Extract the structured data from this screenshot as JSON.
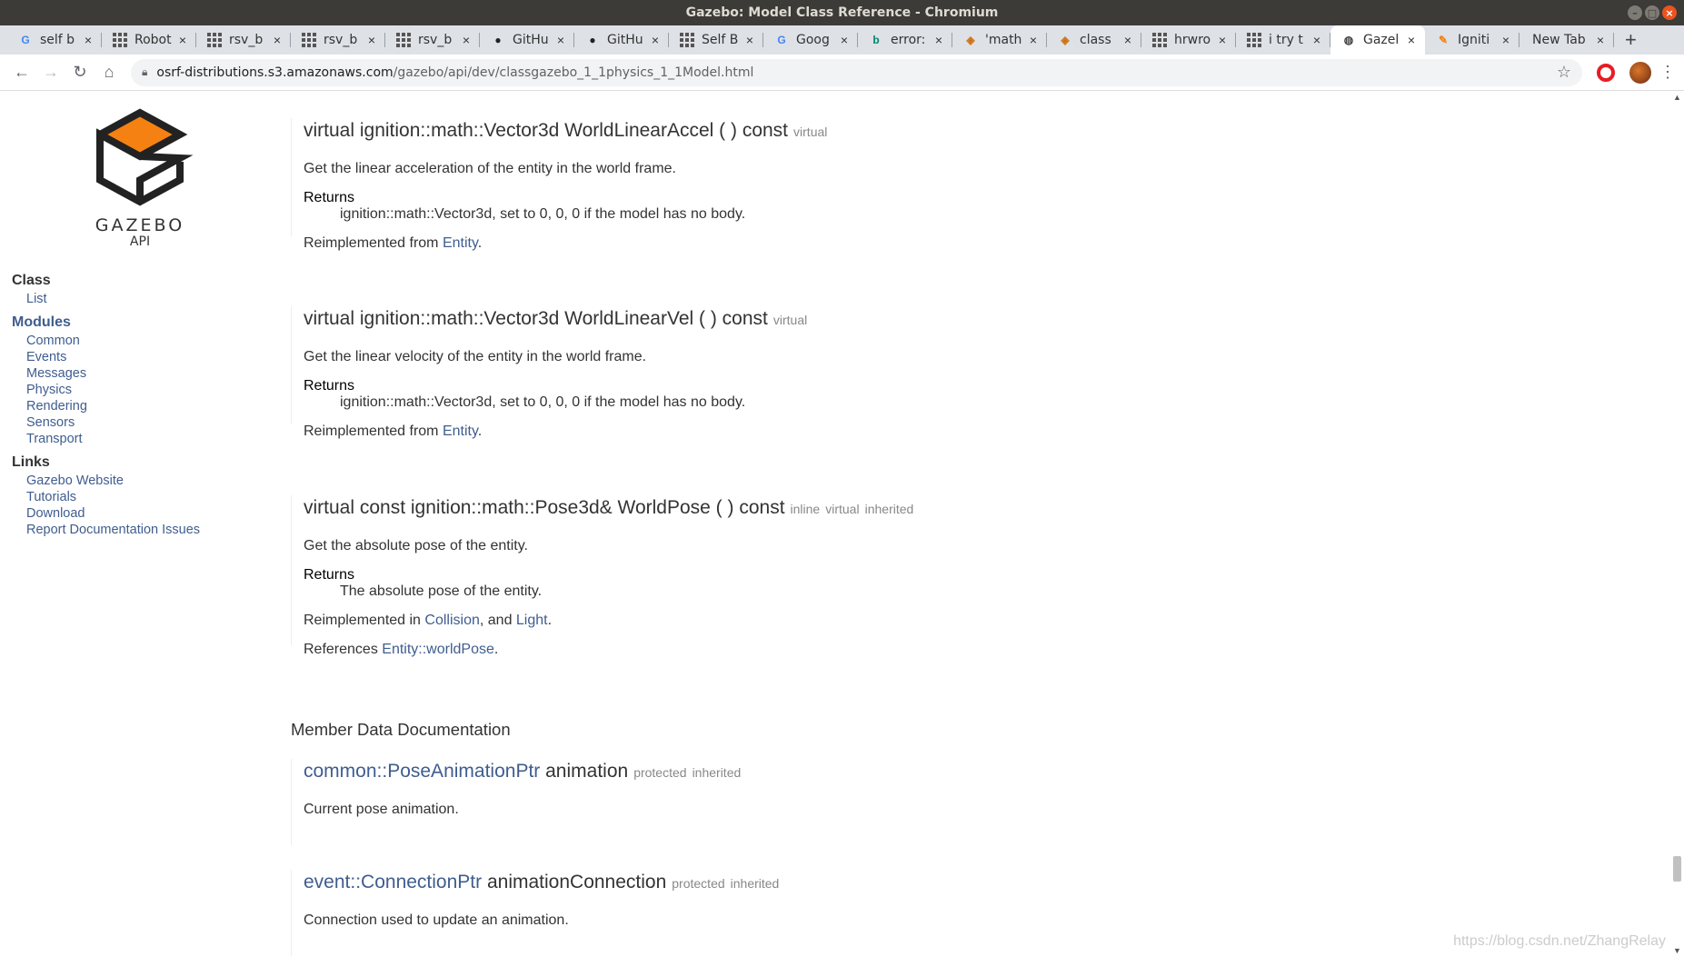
{
  "window": {
    "title": "Gazebo: Model Class Reference - Chromium",
    "controls": [
      "minimize-icon",
      "maximize-icon",
      "close-icon"
    ]
  },
  "tabs": [
    {
      "icon": "google-icon",
      "label": "self b",
      "active": false
    },
    {
      "icon": "apps-grid-icon",
      "label": "Robot",
      "active": false
    },
    {
      "icon": "apps-grid-icon",
      "label": "rsv_b",
      "active": false
    },
    {
      "icon": "apps-grid-icon",
      "label": "rsv_b",
      "active": false
    },
    {
      "icon": "apps-grid-icon",
      "label": "rsv_b",
      "active": false
    },
    {
      "icon": "github-icon",
      "label": "GitHu",
      "active": false
    },
    {
      "icon": "github-icon",
      "label": "GitHu",
      "active": false
    },
    {
      "icon": "apps-grid-icon",
      "label": "Self B",
      "active": false
    },
    {
      "icon": "google-translate-icon",
      "label": "Goog",
      "active": false
    },
    {
      "icon": "bing-icon",
      "label": "error:",
      "active": false
    },
    {
      "icon": "gazebo-icon",
      "label": "'math",
      "active": false
    },
    {
      "icon": "gazebo-icon",
      "label": "class",
      "active": false
    },
    {
      "icon": "apps-grid-icon",
      "label": "hrwro",
      "active": false
    },
    {
      "icon": "apps-grid-icon",
      "label": "i try t",
      "active": false
    },
    {
      "icon": "globe-icon",
      "label": "Gazel",
      "active": true
    },
    {
      "icon": "ignition-icon",
      "label": "Igniti",
      "active": false
    },
    {
      "icon": "",
      "label": "New Tab",
      "active": false
    }
  ],
  "toolbar": {
    "url_host": "osrf-distributions.s3.amazonaws.com",
    "url_path": "/gazebo/api/dev/classgazebo_1_1physics_1_1Model.html"
  },
  "sidebar": {
    "logo_text": "GAZEBO",
    "logo_sub": "API",
    "class_heading": "Class",
    "class_links": [
      "List"
    ],
    "modules_heading": "Modules",
    "module_links": [
      "Common",
      "Events",
      "Messages",
      "Physics",
      "Rendering",
      "Sensors",
      "Transport"
    ],
    "links_heading": "Links",
    "links": [
      "Gazebo Website",
      "Tutorials",
      "Download",
      "Report Documentation Issues"
    ]
  },
  "members": [
    {
      "proto": "virtual ignition::math::Vector3d WorldLinearAccel (  ) const",
      "tags": [
        "virtual"
      ],
      "desc": "Get the linear acceleration of the entity in the world frame.",
      "returns_label": "Returns",
      "returns": "ignition::math::Vector3d, set to 0, 0, 0 if the model has no body.",
      "reimpl_prefix": "Reimplemented from ",
      "reimpl_links": [
        "Entity"
      ]
    },
    {
      "proto": "virtual ignition::math::Vector3d WorldLinearVel (  ) const",
      "tags": [
        "virtual"
      ],
      "desc": "Get the linear velocity of the entity in the world frame.",
      "returns_label": "Returns",
      "returns": "ignition::math::Vector3d, set to 0, 0, 0 if the model has no body.",
      "reimpl_prefix": "Reimplemented from ",
      "reimpl_links": [
        "Entity"
      ]
    },
    {
      "proto": "virtual const ignition::math::Pose3d& WorldPose (  ) const",
      "tags": [
        "inline",
        "virtual",
        "inherited"
      ],
      "desc": "Get the absolute pose of the entity.",
      "returns_label": "Returns",
      "returns": "The absolute pose of the entity.",
      "reimpl_prefix": "Reimplemented in ",
      "reimpl_links": [
        "Collision",
        "Light"
      ],
      "refs_prefix": "References ",
      "refs_link": "Entity::worldPose"
    }
  ],
  "member_data_heading": "Member Data Documentation",
  "data_members": [
    {
      "type_link": "common::PoseAnimationPtr",
      "name": "animation",
      "tags": [
        "protected",
        "inherited"
      ],
      "desc": "Current pose animation."
    },
    {
      "type_link": "event::ConnectionPtr",
      "name": "animationConnection",
      "tags": [
        "protected",
        "inherited"
      ],
      "desc": "Connection used to update an animation."
    }
  ],
  "watermark": "https://blog.csdn.net/ZhangRelay"
}
